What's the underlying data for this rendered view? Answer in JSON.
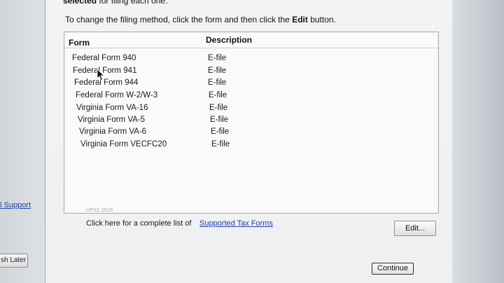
{
  "header": {
    "top_bold": "selected",
    "top_rest": " for filing each one.",
    "instruction_prefix": "To change the filing method, click the form and then click the ",
    "instruction_bold": "Edit",
    "instruction_suffix": " button."
  },
  "table": {
    "col_form": "Form",
    "col_description": "Description",
    "rows": [
      {
        "form": "Federal Form 940",
        "description": "E-file"
      },
      {
        "form": "Federal Form 941",
        "description": "E-file"
      },
      {
        "form": "Federal Form 944",
        "description": "E-file"
      },
      {
        "form": "Federal Form W-2/W-3",
        "description": "E-file"
      },
      {
        "form": "Virginia Form VA-16",
        "description": "E-file"
      },
      {
        "form": "Virginia Form VA-5",
        "description": "E-file"
      },
      {
        "form": "Virginia Form VA-6",
        "description": "E-file"
      },
      {
        "form": "Virginia Form VECFC20",
        "description": "E-file"
      }
    ]
  },
  "footer": {
    "version": "UPS2 2518",
    "complete_list_text": "Click here for a complete list of",
    "supported_link": "Supported Tax Forms",
    "edit_label": "Edit...",
    "continue_label": "Continue"
  },
  "sidebar": {
    "support_link": "l Support",
    "finish_later_label": "sh Later"
  }
}
